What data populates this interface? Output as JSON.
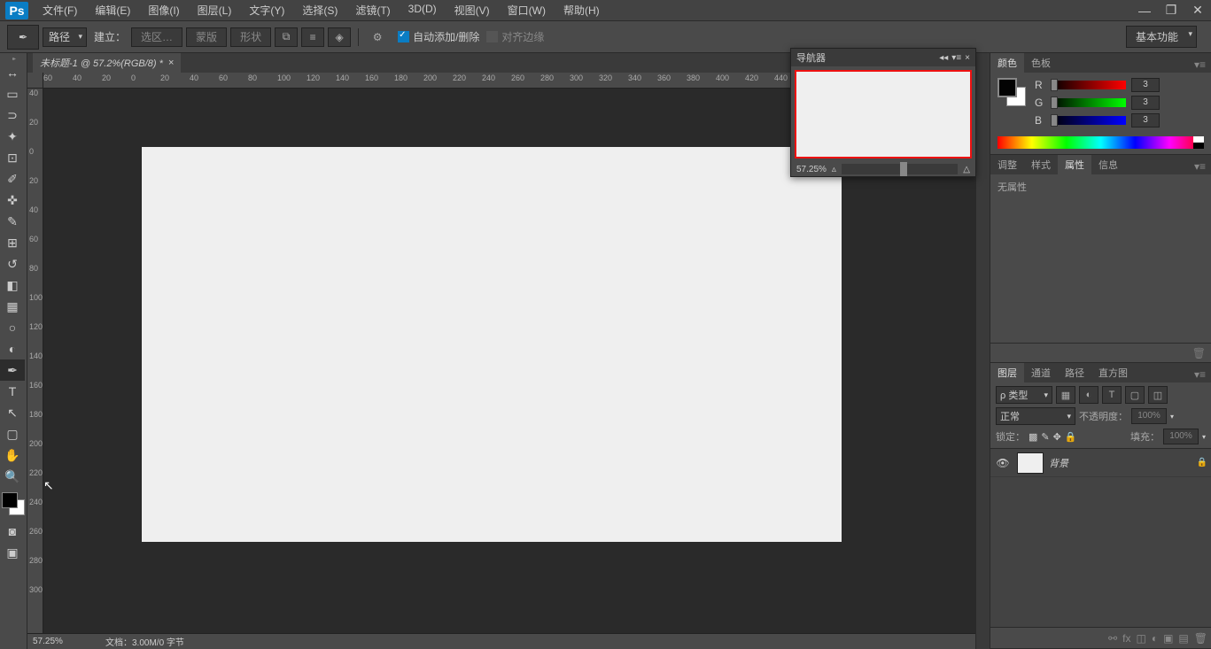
{
  "menu": {
    "file": "文件(F)",
    "edit": "编辑(E)",
    "image": "图像(I)",
    "layer": "图层(L)",
    "type": "文字(Y)",
    "select": "选择(S)",
    "filter": "滤镜(T)",
    "threed": "3D(D)",
    "view": "视图(V)",
    "window": "窗口(W)",
    "help": "帮助(H)"
  },
  "options": {
    "mode": "路径",
    "make": "建立：",
    "selection": "选区…",
    "mask": "蒙版",
    "shape": "形状",
    "auto_add_delete": "自动添加/删除",
    "align_edges": "对齐边缘",
    "workspace": "基本功能"
  },
  "doc": {
    "tab_title": "未标题-1 @ 57.2%(RGB/8) *",
    "zoom_status": "57.25%",
    "size_status": "文档：3.00M/0 字节"
  },
  "ruler_top": [
    "60",
    "40",
    "20",
    "0",
    "20",
    "40",
    "60",
    "80",
    "100",
    "120",
    "140",
    "160",
    "180",
    "200",
    "220",
    "240",
    "260",
    "280",
    "300",
    "320",
    "340",
    "360",
    "380",
    "400",
    "420",
    "440"
  ],
  "ruler_left": [
    "40",
    "20",
    "0",
    "20",
    "40",
    "60",
    "80",
    "100",
    "120",
    "140",
    "160",
    "180",
    "200",
    "220",
    "240",
    "260",
    "280",
    "300"
  ],
  "navigator": {
    "title": "导航器",
    "zoom": "57.25%"
  },
  "panel_color": {
    "tab_color": "颜色",
    "tab_swatches": "色板",
    "r_label": "R",
    "g_label": "G",
    "b_label": "B",
    "r_val": "3",
    "g_val": "3",
    "b_val": "3"
  },
  "panel_props": {
    "tab_adjust": "调整",
    "tab_styles": "样式",
    "tab_props": "属性",
    "tab_info": "信息",
    "no_props": "无属性"
  },
  "panel_layers": {
    "tab_layers": "图层",
    "tab_channels": "通道",
    "tab_paths": "路径",
    "tab_histogram": "直方图",
    "kind": "ρ 类型",
    "blend": "正常",
    "opacity_label": "不透明度：",
    "opacity_val": "100%",
    "lock_label": "锁定：",
    "fill_label": "填充：",
    "fill_val": "100%",
    "layer_bg": "背景"
  }
}
